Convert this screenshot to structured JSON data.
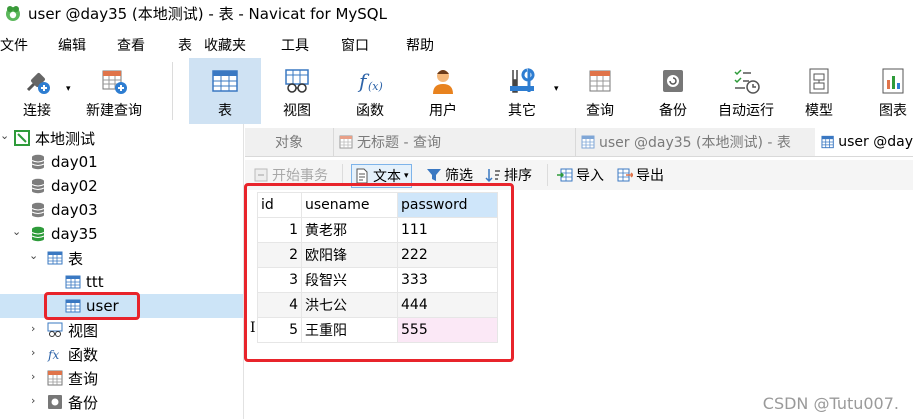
{
  "window": {
    "title": "user @day35 (本地测试) - 表 - Navicat for MySQL"
  },
  "menu": [
    "文件",
    "编辑",
    "查看",
    "表",
    "收藏夹",
    "工具",
    "窗口",
    "帮助"
  ],
  "toolbar": [
    {
      "label": "连接",
      "icon": "connection-icon"
    },
    {
      "label": "新建查询",
      "icon": "new-query-icon"
    },
    {
      "label": "表",
      "icon": "table-icon",
      "active": true
    },
    {
      "label": "视图",
      "icon": "view-icon"
    },
    {
      "label": "函数",
      "icon": "function-icon"
    },
    {
      "label": "用户",
      "icon": "user-icon"
    },
    {
      "label": "其它",
      "icon": "tools-icon"
    },
    {
      "label": "查询",
      "icon": "query-icon"
    },
    {
      "label": "备份",
      "icon": "backup-icon"
    },
    {
      "label": "自动运行",
      "icon": "schedule-icon"
    },
    {
      "label": "模型",
      "icon": "model-icon"
    },
    {
      "label": "图表",
      "icon": "chart-icon"
    }
  ],
  "tree": {
    "connection": "本地测试",
    "databases": [
      "day01",
      "day02",
      "day03",
      "day35"
    ],
    "tables_group": "表",
    "tables": [
      "ttt",
      "user"
    ],
    "views": "视图",
    "functions": "函数",
    "queries": "查询",
    "backups": "备份"
  },
  "tabs": [
    "对象",
    "无标题 - 查询",
    "user @day35 (本地测试) - 表",
    "user @day"
  ],
  "subtoolbar": {
    "begin_transaction": "开始事务",
    "text": "文本",
    "filter": "筛选",
    "sort": "排序",
    "import": "导入",
    "export": "导出"
  },
  "grid": {
    "columns": [
      "id",
      "usename",
      "password"
    ],
    "rows": [
      {
        "id": "1",
        "usename": "黄老邪",
        "password": "111"
      },
      {
        "id": "2",
        "usename": "欧阳锋",
        "password": "222"
      },
      {
        "id": "3",
        "usename": "段智兴",
        "password": "333"
      },
      {
        "id": "4",
        "usename": "洪七公",
        "password": "444"
      },
      {
        "id": "5",
        "usename": "王重阳",
        "password": "555"
      }
    ]
  },
  "cursor_glyph": "I",
  "watermark": "CSDN @Tutu007.",
  "colors": {
    "highlight_box": "#e8242b",
    "selection": "#cce4f7",
    "active_tool": "#cfe2f3"
  }
}
